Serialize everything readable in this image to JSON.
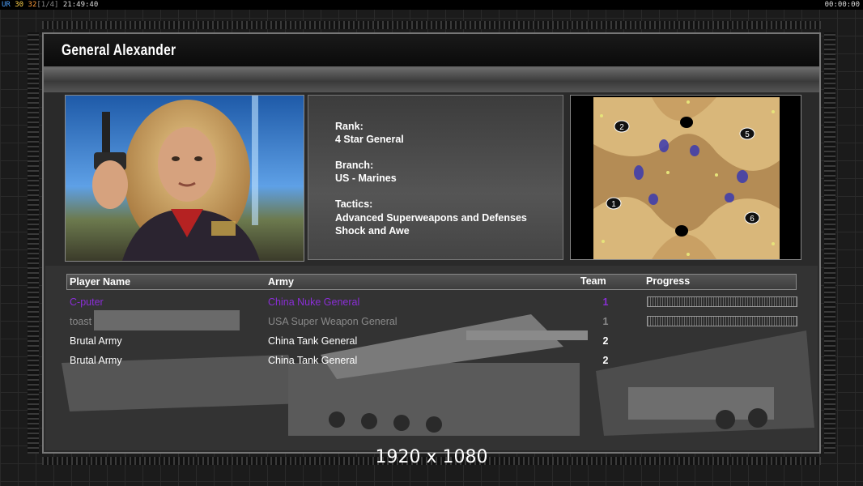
{
  "status": {
    "ur_label": "UR",
    "v1": "30",
    "v2": "32",
    "bracket": "[1/4]",
    "clock": "21:49:40",
    "timer": "00:00:00"
  },
  "general": {
    "name": "General Alexander",
    "rank_label": "Rank:",
    "rank": "4 Star General",
    "branch_label": "Branch:",
    "branch": "US - Marines",
    "tactics_label": "Tactics:",
    "tactics_line1": "Advanced Superweapons and Defenses",
    "tactics_line2": "Shock and Awe"
  },
  "minimap": {
    "start_positions": [
      "2",
      "5",
      "1",
      "6"
    ]
  },
  "table": {
    "headers": {
      "player": "Player Name",
      "army": "Army",
      "team": "Team",
      "progress": "Progress"
    },
    "rows": [
      {
        "player": "C-puter",
        "army": "China Nuke General",
        "team": "1",
        "color": "#8a2ed6"
      },
      {
        "player": "toast",
        "army": "USA Super Weapon General",
        "team": "1",
        "color": "#8a8a8a"
      },
      {
        "player": "Brutal Army",
        "army": "China Tank General",
        "team": "2",
        "color": "#ffffff"
      },
      {
        "player": "Brutal Army",
        "army": "China Tank General",
        "team": "2",
        "color": "#ffffff"
      }
    ]
  },
  "resolution": "1920 x 1080"
}
